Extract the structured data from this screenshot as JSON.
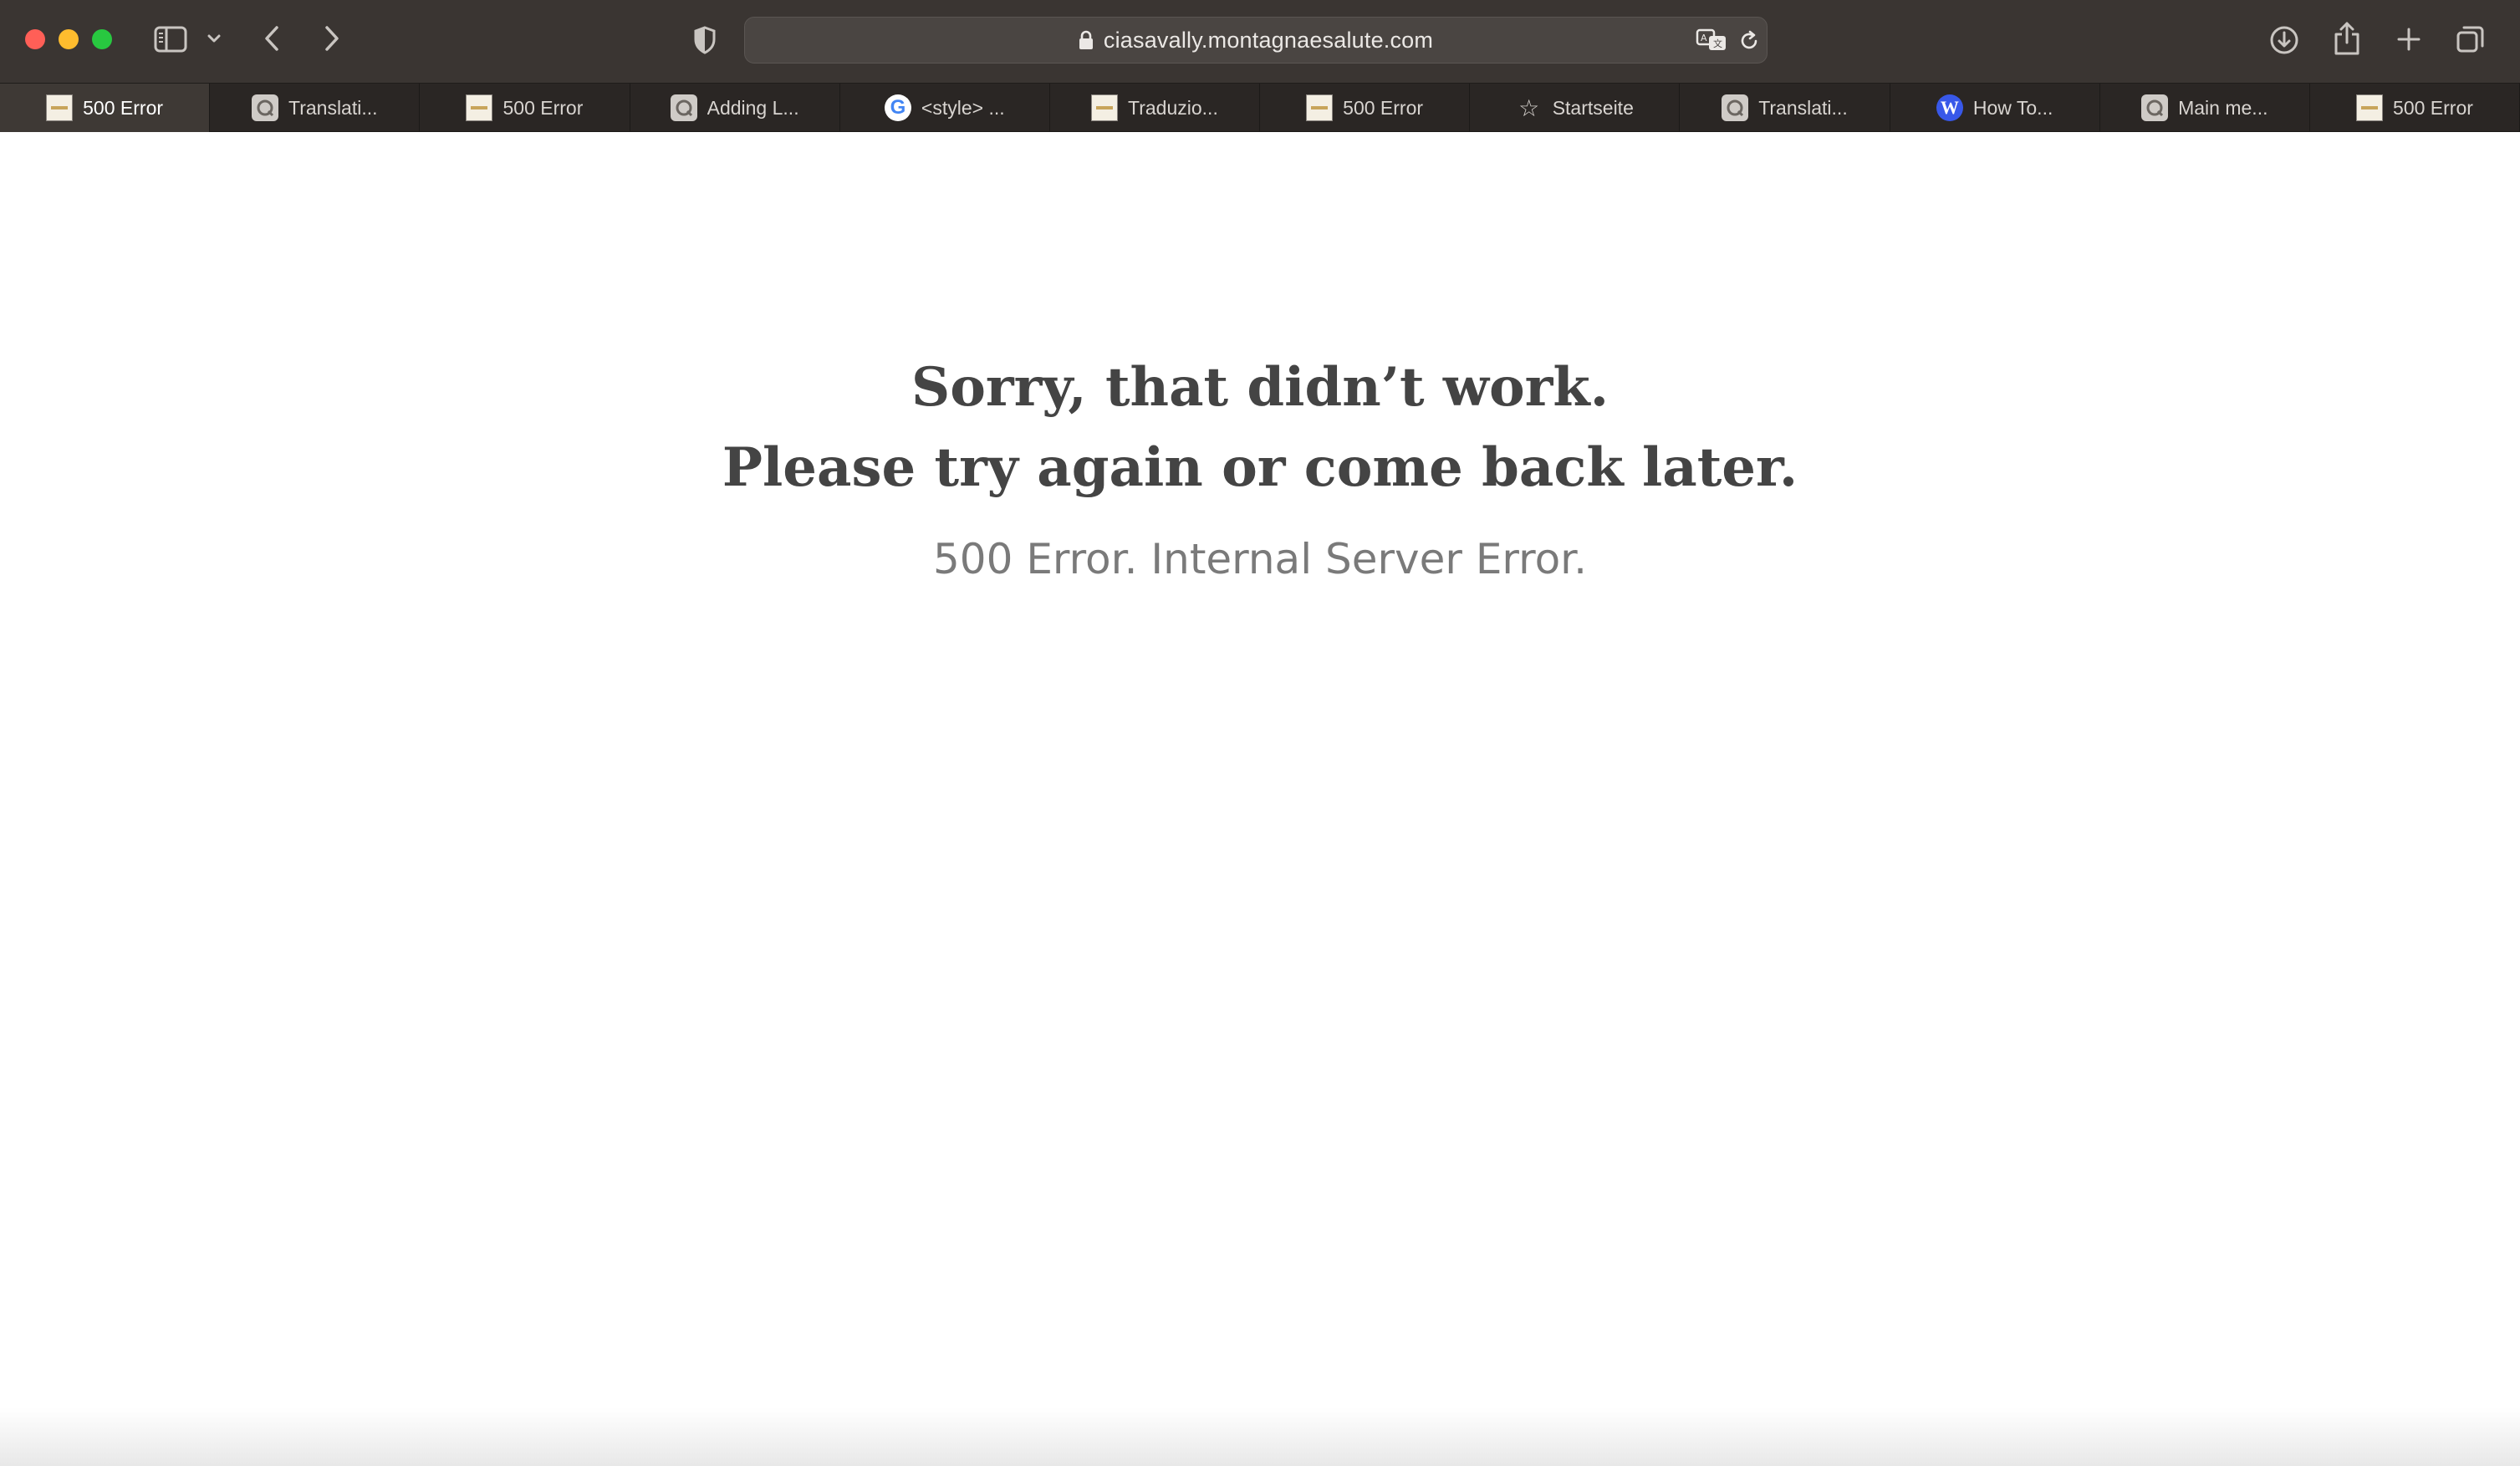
{
  "browser": {
    "url": "ciasavally.montagnaesalute.com",
    "tabs": [
      {
        "label": "500 Error",
        "favicon": "site-image-icon",
        "active": true
      },
      {
        "label": "Translati...",
        "favicon": "q-icon",
        "active": false
      },
      {
        "label": "500 Error",
        "favicon": "site-image-icon",
        "active": false
      },
      {
        "label": "Adding L...",
        "favicon": "q-icon",
        "active": false
      },
      {
        "label": "<style> ...",
        "favicon": "google-icon",
        "active": false
      },
      {
        "label": "Traduzio...",
        "favicon": "site-image-icon",
        "active": false
      },
      {
        "label": "500 Error",
        "favicon": "site-image-icon",
        "active": false
      },
      {
        "label": "Startseite",
        "favicon": "star-icon",
        "active": false
      },
      {
        "label": "Translati...",
        "favicon": "q-icon",
        "active": false
      },
      {
        "label": "How To...",
        "favicon": "wordpress-icon",
        "active": false
      },
      {
        "label": "Main me...",
        "favicon": "q-icon",
        "active": false
      },
      {
        "label": "500 Error",
        "favicon": "site-image-icon",
        "active": false
      }
    ]
  },
  "page": {
    "title_line1": "Sorry, that didn’t work.",
    "title_line2": "Please try again or come back later.",
    "subtitle": "500 Error. Internal Server Error."
  },
  "colors": {
    "toolbar_bg": "#3a3532",
    "tabbar_bg": "#2a2624",
    "active_tab_bg": "#3e3935",
    "title_color": "#444444",
    "subtitle_color": "#7a7a7a"
  }
}
